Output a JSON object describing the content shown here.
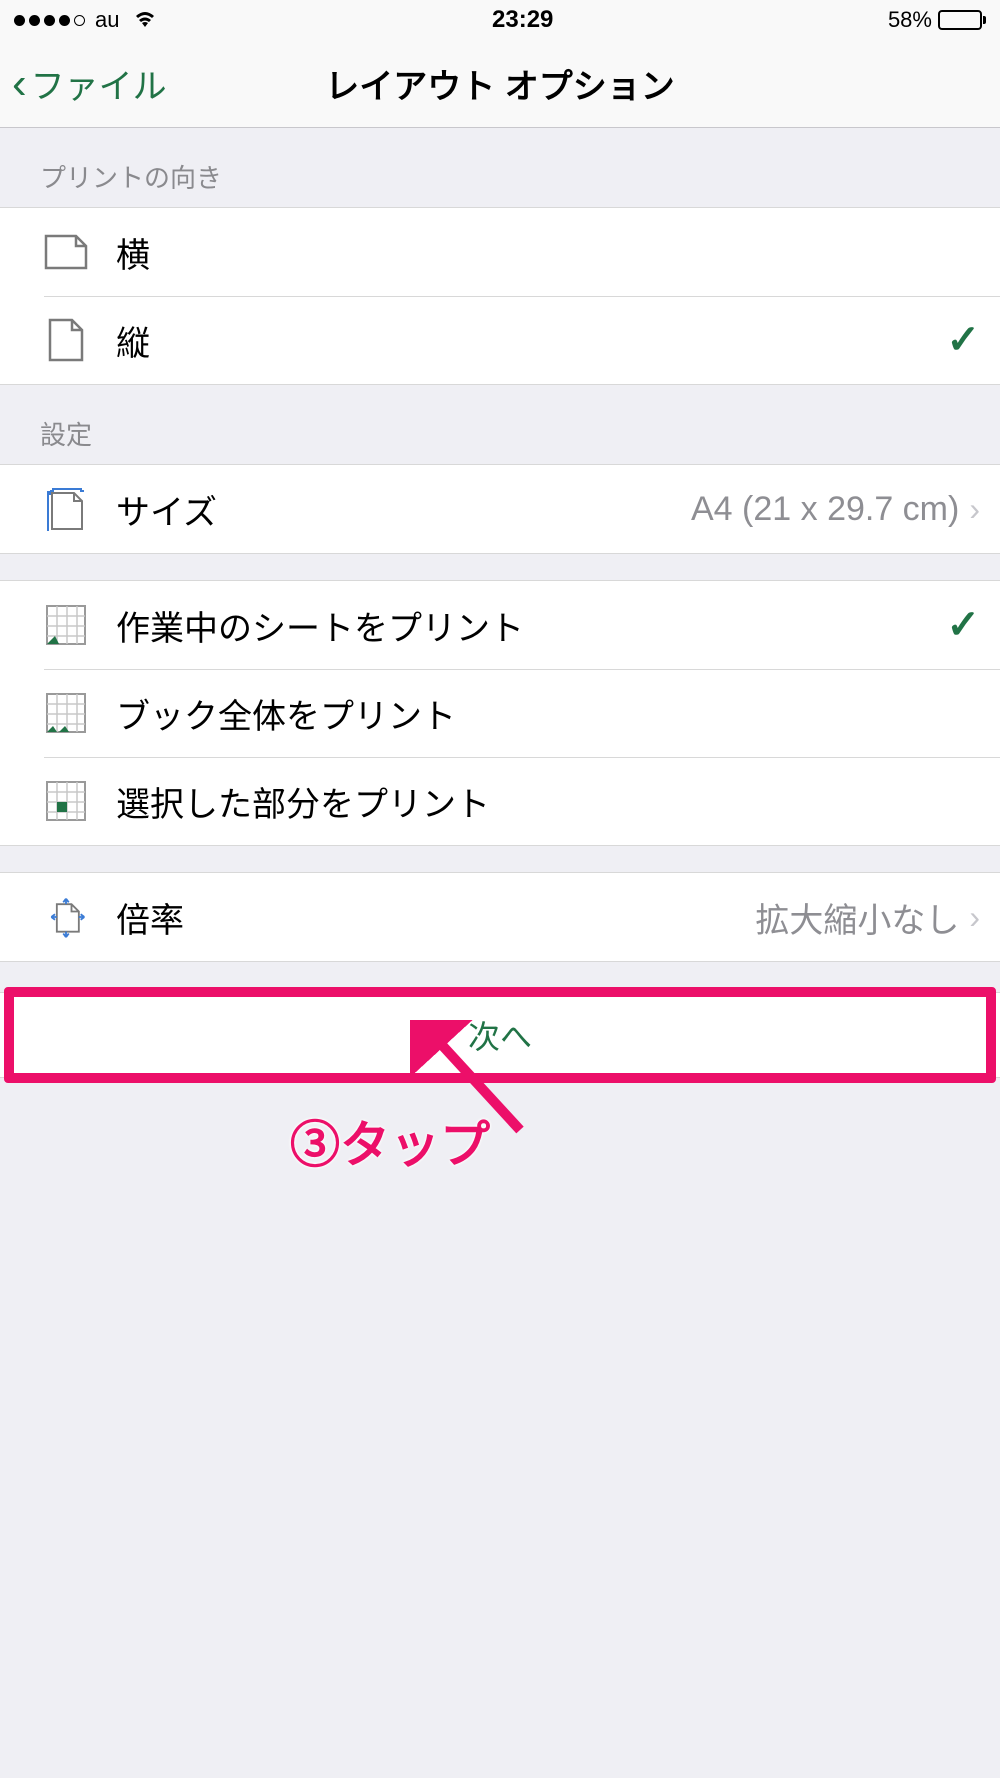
{
  "status": {
    "carrier": "au",
    "time": "23:29",
    "battery_pct": "58%"
  },
  "nav": {
    "back_label": "ファイル",
    "title": "レイアウト オプション"
  },
  "sections": {
    "orientation_header": "プリントの向き",
    "settings_header": "設定"
  },
  "orientation": {
    "landscape": "横",
    "portrait": "縦"
  },
  "settings": {
    "size_label": "サイズ",
    "size_value": "A4 (21 x 29.7 cm)",
    "print_active_sheet": "作業中のシートをプリント",
    "print_entire_book": "ブック全体をプリント",
    "print_selection": "選択した部分をプリント",
    "scale_label": "倍率",
    "scale_value": "拡大縮小なし"
  },
  "next_button": "次へ",
  "annotation": "③タップ",
  "colors": {
    "accent": "#217346",
    "highlight": "#ec0f69"
  }
}
